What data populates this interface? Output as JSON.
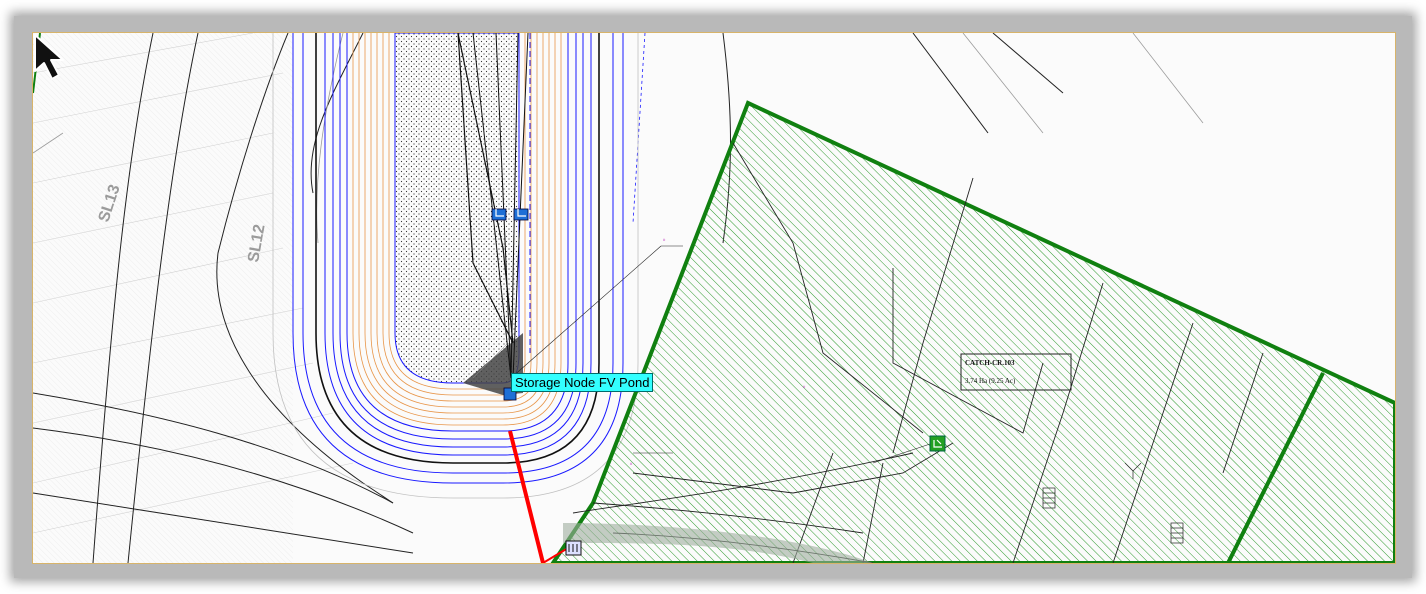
{
  "tooltip": {
    "text": "Storage Node FV Pond"
  },
  "labels": {
    "sl13": "SL13",
    "sl12": "SL12",
    "catchment_name": "CATCH-CR.103",
    "catchment_area": "3.74 Ha (9.25 Ac)"
  },
  "colors": {
    "canvas": "#fbfbfb",
    "frame": "#b9b9b9",
    "catchment_border": "#108010",
    "catchment_hatch": "#2e9a2e",
    "conduit": "#ff0000",
    "tooltip_bg": "#33ffff",
    "contour_blue": "#1a1aff",
    "contour_orange": "#e8964a"
  },
  "icons": [
    "storage-node-icon",
    "outfall-node-icon",
    "inlet-node-icon",
    "junction-node-icon",
    "mouse-pointer-icon"
  ]
}
